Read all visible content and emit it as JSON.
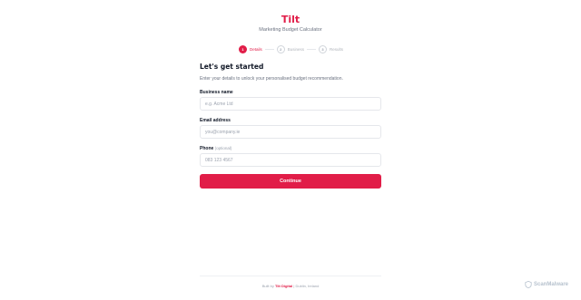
{
  "header": {
    "brand": "Tilt",
    "subtitle": "Marketing Budget Calculator"
  },
  "stepper": {
    "steps": [
      {
        "number": "1",
        "label": "Details",
        "state": "active"
      },
      {
        "number": "2",
        "label": "Business",
        "state": "inactive"
      },
      {
        "number": "3",
        "label": "Results",
        "state": "inactive"
      }
    ]
  },
  "form": {
    "heading": "Let's get started",
    "intro": "Enter your details to unlock your personalised budget recommendation.",
    "fields": {
      "business_name": {
        "label": "Business name",
        "placeholder": "e.g. Acme Ltd",
        "value": ""
      },
      "email": {
        "label": "Email address",
        "placeholder": "you@company.ie",
        "value": ""
      },
      "phone": {
        "label": "Phone",
        "optional_note": "(optional)",
        "placeholder": "083 123 4567",
        "value": ""
      }
    },
    "continue_label": "Continue"
  },
  "footer": {
    "prefix": "Built by",
    "link": "Tilt Digital",
    "suffix": "| Dublin, Ireland"
  },
  "watermark": {
    "text": "ScanMalware"
  },
  "colors": {
    "accent": "#e11d48",
    "text": "#111827",
    "muted": "#6b7280",
    "border": "#e5e7eb"
  }
}
